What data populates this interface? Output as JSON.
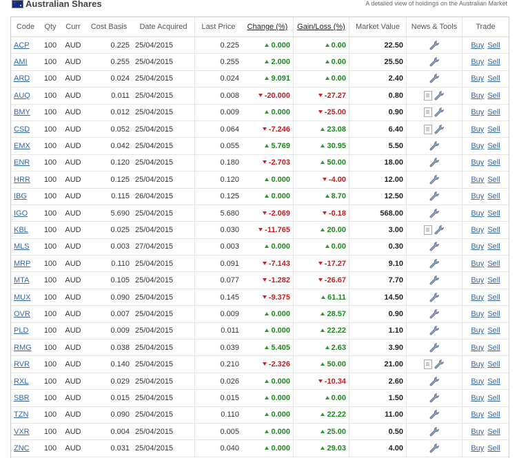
{
  "header": {
    "title": "Australian Shares",
    "subtitle": "A detailed view of holdings on the Australian Market"
  },
  "columns": [
    "Code",
    "Qty",
    "Curr",
    "Cost Basis",
    "Date Acquired",
    "Last Price",
    "Change (%)",
    "Gain/Loss (%)",
    "Market Value",
    "News & Tools",
    "Trade"
  ],
  "trade_labels": {
    "buy": "Buy",
    "sell": "Sell"
  },
  "colors": {
    "up": "#1a8a1a",
    "down": "#cc1a1a",
    "link": "#3366aa"
  },
  "rows": [
    {
      "code": "ACP",
      "qty": "100",
      "curr": "AUD",
      "cost": "0.225",
      "date": "25/04/2015",
      "last": "0.225",
      "chg": "0.000",
      "chg_dir": "up",
      "gl": "0.00",
      "gl_dir": "up",
      "mv": "22.50",
      "news": false
    },
    {
      "code": "AMI",
      "qty": "100",
      "curr": "AUD",
      "cost": "0.255",
      "date": "25/04/2015",
      "last": "0.255",
      "chg": "2.000",
      "chg_dir": "up",
      "gl": "0.00",
      "gl_dir": "up",
      "mv": "25.50",
      "news": false
    },
    {
      "code": "ARD",
      "qty": "100",
      "curr": "AUD",
      "cost": "0.024",
      "date": "25/04/2015",
      "last": "0.024",
      "chg": "9.091",
      "chg_dir": "up",
      "gl": "0.00",
      "gl_dir": "up",
      "mv": "2.40",
      "news": false
    },
    {
      "code": "AUQ",
      "qty": "100",
      "curr": "AUD",
      "cost": "0.011",
      "date": "25/04/2015",
      "last": "0.008",
      "chg": "-20.000",
      "chg_dir": "down",
      "gl": "-27.27",
      "gl_dir": "down",
      "mv": "0.80",
      "news": true
    },
    {
      "code": "BMY",
      "qty": "100",
      "curr": "AUD",
      "cost": "0.012",
      "date": "25/04/2015",
      "last": "0.009",
      "chg": "0.000",
      "chg_dir": "up",
      "gl": "-25.00",
      "gl_dir": "down",
      "mv": "0.90",
      "news": true
    },
    {
      "code": "CSD",
      "qty": "100",
      "curr": "AUD",
      "cost": "0.052",
      "date": "25/04/2015",
      "last": "0.064",
      "chg": "-7.246",
      "chg_dir": "down",
      "gl": "23.08",
      "gl_dir": "up",
      "mv": "6.40",
      "news": true
    },
    {
      "code": "EMX",
      "qty": "100",
      "curr": "AUD",
      "cost": "0.042",
      "date": "25/04/2015",
      "last": "0.055",
      "chg": "5.769",
      "chg_dir": "up",
      "gl": "30.95",
      "gl_dir": "up",
      "mv": "5.50",
      "news": false
    },
    {
      "code": "ENR",
      "qty": "100",
      "curr": "AUD",
      "cost": "0.120",
      "date": "25/04/2015",
      "last": "0.180",
      "chg": "-2.703",
      "chg_dir": "down",
      "gl": "50.00",
      "gl_dir": "up",
      "mv": "18.00",
      "news": false
    },
    {
      "code": "HRR",
      "qty": "100",
      "curr": "AUD",
      "cost": "0.125",
      "date": "25/04/2015",
      "last": "0.120",
      "chg": "0.000",
      "chg_dir": "up",
      "gl": "-4.00",
      "gl_dir": "down",
      "mv": "12.00",
      "news": false
    },
    {
      "code": "IBG",
      "qty": "100",
      "curr": "AUD",
      "cost": "0.115",
      "date": "26/04/2015",
      "last": "0.125",
      "chg": "0.000",
      "chg_dir": "up",
      "gl": "8.70",
      "gl_dir": "up",
      "mv": "12.50",
      "news": false
    },
    {
      "code": "IGO",
      "qty": "100",
      "curr": "AUD",
      "cost": "5.690",
      "date": "25/04/2015",
      "last": "5.680",
      "chg": "-2.069",
      "chg_dir": "down",
      "gl": "-0.18",
      "gl_dir": "down",
      "mv": "568.00",
      "news": false
    },
    {
      "code": "KBL",
      "qty": "100",
      "curr": "AUD",
      "cost": "0.025",
      "date": "25/04/2015",
      "last": "0.030",
      "chg": "-11.765",
      "chg_dir": "down",
      "gl": "20.00",
      "gl_dir": "up",
      "mv": "3.00",
      "news": true
    },
    {
      "code": "MLS",
      "qty": "100",
      "curr": "AUD",
      "cost": "0.003",
      "date": "27/04/2015",
      "last": "0.003",
      "chg": "0.000",
      "chg_dir": "up",
      "gl": "0.00",
      "gl_dir": "up",
      "mv": "0.30",
      "news": false
    },
    {
      "code": "MRP",
      "qty": "100",
      "curr": "AUD",
      "cost": "0.110",
      "date": "25/04/2015",
      "last": "0.091",
      "chg": "-7.143",
      "chg_dir": "down",
      "gl": "-17.27",
      "gl_dir": "down",
      "mv": "9.10",
      "news": false
    },
    {
      "code": "MTA",
      "qty": "100",
      "curr": "AUD",
      "cost": "0.105",
      "date": "25/04/2015",
      "last": "0.077",
      "chg": "-1.282",
      "chg_dir": "down",
      "gl": "-26.67",
      "gl_dir": "down",
      "mv": "7.70",
      "news": false
    },
    {
      "code": "MUX",
      "qty": "100",
      "curr": "AUD",
      "cost": "0.090",
      "date": "25/04/2015",
      "last": "0.145",
      "chg": "-9.375",
      "chg_dir": "down",
      "gl": "61.11",
      "gl_dir": "up",
      "mv": "14.50",
      "news": false
    },
    {
      "code": "OVR",
      "qty": "100",
      "curr": "AUD",
      "cost": "0.007",
      "date": "25/04/2015",
      "last": "0.009",
      "chg": "0.000",
      "chg_dir": "up",
      "gl": "28.57",
      "gl_dir": "up",
      "mv": "0.90",
      "news": false
    },
    {
      "code": "PLD",
      "qty": "100",
      "curr": "AUD",
      "cost": "0.009",
      "date": "25/04/2015",
      "last": "0.011",
      "chg": "0.000",
      "chg_dir": "up",
      "gl": "22.22",
      "gl_dir": "up",
      "mv": "1.10",
      "news": false
    },
    {
      "code": "RMG",
      "qty": "100",
      "curr": "AUD",
      "cost": "0.038",
      "date": "25/04/2015",
      "last": "0.039",
      "chg": "5.405",
      "chg_dir": "up",
      "gl": "2.63",
      "gl_dir": "up",
      "mv": "3.90",
      "news": false
    },
    {
      "code": "RVR",
      "qty": "100",
      "curr": "AUD",
      "cost": "0.140",
      "date": "25/04/2015",
      "last": "0.210",
      "chg": "-2.326",
      "chg_dir": "down",
      "gl": "50.00",
      "gl_dir": "up",
      "mv": "21.00",
      "news": true
    },
    {
      "code": "RXL",
      "qty": "100",
      "curr": "AUD",
      "cost": "0.029",
      "date": "25/04/2015",
      "last": "0.026",
      "chg": "0.000",
      "chg_dir": "up",
      "gl": "-10.34",
      "gl_dir": "down",
      "mv": "2.60",
      "news": false
    },
    {
      "code": "SBR",
      "qty": "100",
      "curr": "AUD",
      "cost": "0.015",
      "date": "25/04/2015",
      "last": "0.015",
      "chg": "0.000",
      "chg_dir": "up",
      "gl": "0.00",
      "gl_dir": "up",
      "mv": "1.50",
      "news": false
    },
    {
      "code": "TZN",
      "qty": "100",
      "curr": "AUD",
      "cost": "0.090",
      "date": "25/04/2015",
      "last": "0.110",
      "chg": "0.000",
      "chg_dir": "up",
      "gl": "22.22",
      "gl_dir": "up",
      "mv": "11.00",
      "news": false
    },
    {
      "code": "VXR",
      "qty": "100",
      "curr": "AUD",
      "cost": "0.004",
      "date": "25/04/2015",
      "last": "0.005",
      "chg": "0.000",
      "chg_dir": "up",
      "gl": "25.00",
      "gl_dir": "up",
      "mv": "0.50",
      "news": false
    },
    {
      "code": "ZNC",
      "qty": "100",
      "curr": "AUD",
      "cost": "0.031",
      "date": "25/04/2015",
      "last": "0.040",
      "chg": "0.000",
      "chg_dir": "up",
      "gl": "29.03",
      "gl_dir": "up",
      "mv": "4.00",
      "news": false
    }
  ]
}
